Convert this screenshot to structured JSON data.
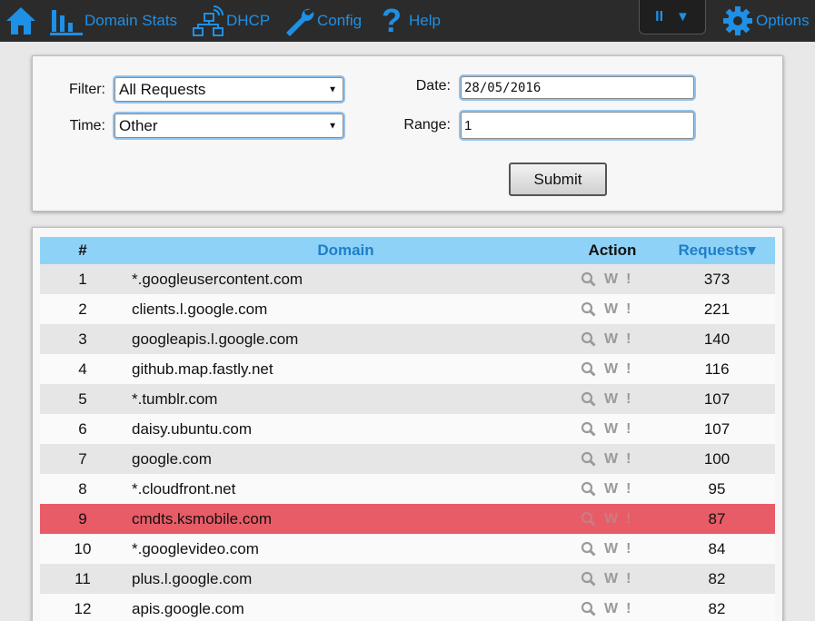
{
  "nav": {
    "home_label": "",
    "domain_stats": "Domain Stats",
    "dhcp": "DHCP",
    "config": "Config",
    "help": "Help",
    "pause_symbol": "II",
    "dropdown_symbol": "▼",
    "options": "Options"
  },
  "form": {
    "filter_label": "Filter:",
    "filter_value": "All Requests",
    "time_label": "Time:",
    "time_value": "Other",
    "date_label": "Date:",
    "date_value": "28/05/2016",
    "range_label": "Range:",
    "range_value": "1",
    "submit_label": "Submit"
  },
  "table": {
    "headers": {
      "num": "#",
      "domain": "Domain",
      "action": "Action",
      "requests": "Requests▾"
    },
    "rows": [
      {
        "num": "1",
        "domain": "*.googleusercontent.com",
        "requests": "373",
        "blocked": false
      },
      {
        "num": "2",
        "domain": "clients.l.google.com",
        "requests": "221",
        "blocked": false
      },
      {
        "num": "3",
        "domain": "googleapis.l.google.com",
        "requests": "140",
        "blocked": false
      },
      {
        "num": "4",
        "domain": "github.map.fastly.net",
        "requests": "116",
        "blocked": false
      },
      {
        "num": "5",
        "domain": "*.tumblr.com",
        "requests": "107",
        "blocked": false
      },
      {
        "num": "6",
        "domain": "daisy.ubuntu.com",
        "requests": "107",
        "blocked": false
      },
      {
        "num": "7",
        "domain": "google.com",
        "requests": "100",
        "blocked": false
      },
      {
        "num": "8",
        "domain": "*.cloudfront.net",
        "requests": "95",
        "blocked": false
      },
      {
        "num": "9",
        "domain": "cmdts.ksmobile.com",
        "requests": "87",
        "blocked": true
      },
      {
        "num": "10",
        "domain": "*.googlevideo.com",
        "requests": "84",
        "blocked": false
      },
      {
        "num": "11",
        "domain": "plus.l.google.com",
        "requests": "82",
        "blocked": false
      },
      {
        "num": "12",
        "domain": "apis.google.com",
        "requests": "82",
        "blocked": false
      }
    ],
    "action_icons": {
      "whois": "W",
      "report": "!"
    }
  },
  "colors": {
    "accent": "#1e90e6",
    "header_bg": "#8fd2f7",
    "blocked_row": "#e85c67",
    "topbar": "#2b2b2b"
  }
}
